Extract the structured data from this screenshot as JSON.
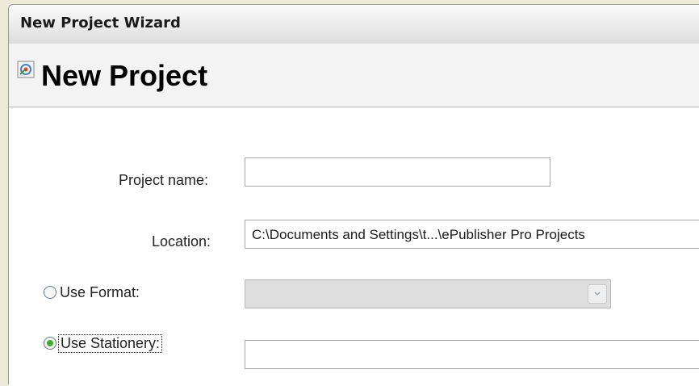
{
  "window": {
    "title": "New Project Wizard"
  },
  "header": {
    "title": "New Project",
    "icon": "wizard-icon"
  },
  "form": {
    "project_name": {
      "label": "Project name:",
      "value": ""
    },
    "location": {
      "label": "Location:",
      "value": "C:\\Documents and Settings\\t...\\ePublisher Pro Projects"
    },
    "use_format": {
      "label": "Use Format:",
      "selected": false,
      "value": "",
      "disabled": true
    },
    "use_stationery": {
      "label": "Use Stationery:",
      "selected": true,
      "value": ""
    }
  },
  "colors": {
    "radio_selected": "#3fae2e",
    "disabled_field": "#dedede"
  }
}
